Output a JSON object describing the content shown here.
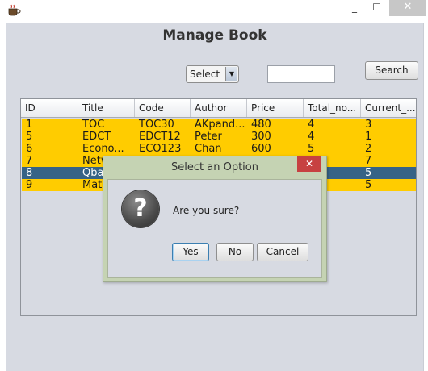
{
  "window": {
    "minimize_glyph": "_",
    "maximize_glyph": "☐",
    "close_glyph": "✕"
  },
  "page": {
    "title": "Manage Book"
  },
  "filter": {
    "select_value": "Select",
    "search_value": "",
    "search_button": "Search"
  },
  "table": {
    "columns": [
      "ID",
      "Title",
      "Code",
      "Author",
      "Price",
      "Total_no...",
      "Current_..."
    ],
    "rows": [
      {
        "id": "1",
        "title": "TOC",
        "code": "TOC30",
        "author": "AKpand...",
        "price": "480",
        "total": "4",
        "current": "3"
      },
      {
        "id": "5",
        "title": "EDCT",
        "code": "EDCT12",
        "author": "Peter",
        "price": "300",
        "total": "4",
        "current": "1"
      },
      {
        "id": "6",
        "title": "Econo...",
        "code": "ECO123",
        "author": "Chan",
        "price": "600",
        "total": "5",
        "current": "2"
      },
      {
        "id": "7",
        "title": "Netw",
        "code": "",
        "author": "",
        "price": "",
        "total": "",
        "current": "7"
      },
      {
        "id": "8",
        "title": "Qbas",
        "code": "",
        "author": "",
        "price": "",
        "total": "",
        "current": "5"
      },
      {
        "id": "9",
        "title": "Math",
        "code": "",
        "author": "",
        "price": "",
        "total": "",
        "current": "5"
      }
    ],
    "selected_row_id": "8"
  },
  "dialog": {
    "title": "Select an Option",
    "close_glyph": "✕",
    "icon_glyph": "?",
    "message": "Are you sure?",
    "buttons": {
      "yes": "Yes",
      "no": "No",
      "cancel": "Cancel"
    }
  },
  "colors": {
    "row_bg": "#ffcc00",
    "selected_row_bg": "#376386",
    "dialog_frame": "#c5d3b3",
    "panel_bg": "#d7dae2"
  },
  "icons": {
    "app": "java-coffee-cup-icon",
    "question": "question-mark-icon"
  }
}
